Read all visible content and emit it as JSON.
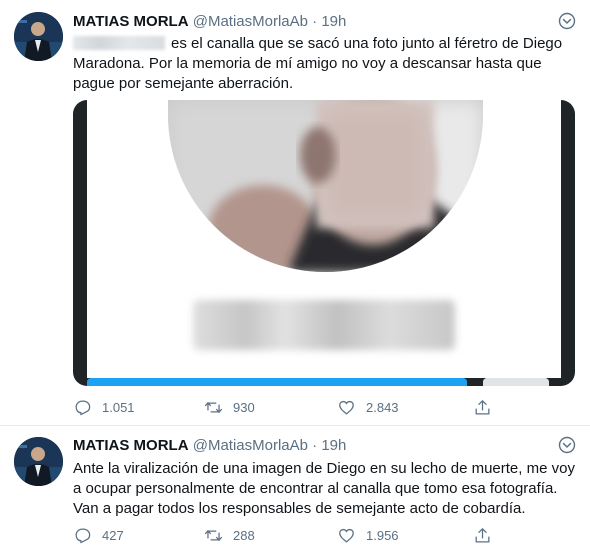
{
  "tweets": [
    {
      "name": "MATIAS MORLA",
      "handle": "@MatiasMorlaAb",
      "separator": "·",
      "time": "19h",
      "text": "es el canalla que se sacó una foto junto al féretro de Diego Maradona. Por la memoria de mí amigo no voy a descansar hasta que pague por semejante aberración.",
      "replies": "1.051",
      "retweets": "930",
      "likes": "2.843"
    },
    {
      "name": "MATIAS MORLA",
      "handle": "@MatiasMorlaAb",
      "separator": "·",
      "time": "19h",
      "text": "Ante la viralización de una imagen de Diego en su lecho de muerte, me voy a ocupar personalmente de encontrar al canalla que tomo esa fotografía. Van a pagar todos los responsables de semejante acto de cobardía.",
      "replies": "427",
      "retweets": "288",
      "likes": "1.956"
    }
  ],
  "icons": {
    "reply": "reply-icon",
    "retweet": "retweet-icon",
    "like": "heart-icon",
    "share": "share-icon",
    "more": "chevron-down-icon"
  },
  "colors": {
    "text": "#0f1419",
    "secondary": "#5b7083",
    "accent": "#1da1f2",
    "divider": "#e6ecf0"
  }
}
